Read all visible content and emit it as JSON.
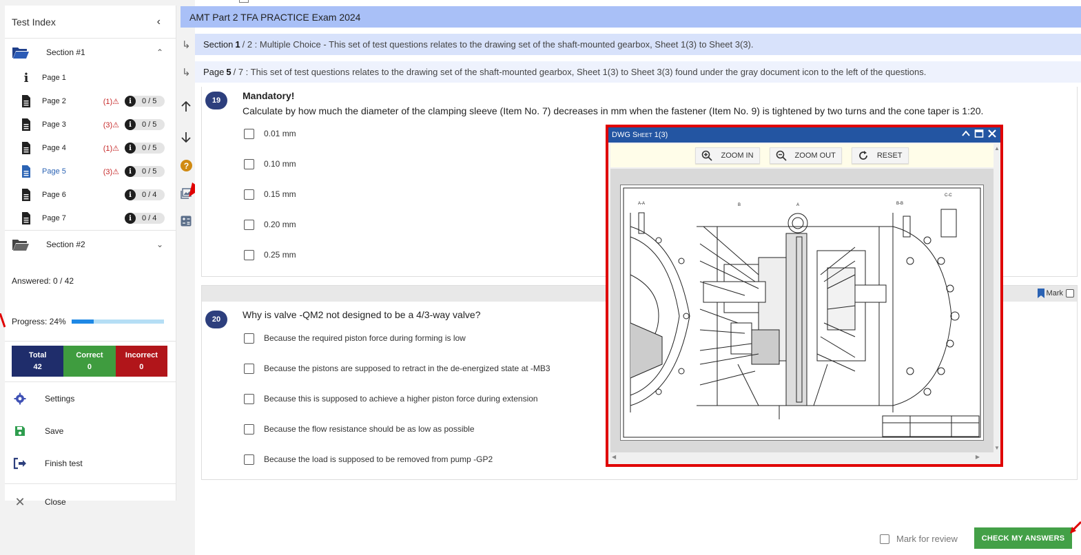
{
  "sidebar": {
    "title": "Test Index",
    "sections": [
      {
        "label": "Section #1"
      },
      {
        "label": "Section #2"
      }
    ],
    "pages": [
      {
        "label": "Page 1",
        "warn": "",
        "score": ""
      },
      {
        "label": "Page 2",
        "warn": "(1)⚠",
        "score": "0 / 5"
      },
      {
        "label": "Page 3",
        "warn": "(3)⚠",
        "score": "0 / 5"
      },
      {
        "label": "Page 4",
        "warn": "(1)⚠",
        "score": "0 / 5"
      },
      {
        "label": "Page 5",
        "warn": "(3)⚠",
        "score": "0 / 5"
      },
      {
        "label": "Page 6",
        "warn": "",
        "score": "0 / 4"
      },
      {
        "label": "Page 7",
        "warn": "",
        "score": "0 / 4"
      }
    ],
    "answered": "Answered: 0 / 42",
    "progress_label": "Progress: 24%",
    "progress_fraction": 0.24,
    "stats": [
      {
        "label": "Total",
        "value": "42",
        "color": "#1f2d6b"
      },
      {
        "label": "Correct",
        "value": "0",
        "color": "#3f9c3f"
      },
      {
        "label": "Incorrect",
        "value": "0",
        "color": "#b1151a"
      }
    ],
    "menu": [
      {
        "label": "Settings",
        "icon": "gear-icon"
      },
      {
        "label": "Save",
        "icon": "save-icon"
      },
      {
        "label": "Finish test",
        "icon": "exit-icon"
      },
      {
        "label": "Close",
        "icon": "close-icon"
      }
    ]
  },
  "header": {
    "title": "AMT Part 2 TFA PRACTICE Exam 2024",
    "section_prefix": "Section",
    "section_num": "1",
    "section_total": "/ 2 : Multiple Choice - This set of test questions relates to the drawing set of the shaft-mounted gearbox, Sheet 1(3) to Sheet 3(3).",
    "page_prefix": "Page",
    "page_num": "5",
    "page_total": "/ 7 : This set of test questions relates to the drawing set of the shaft-mounted gearbox, Sheet 1(3) to Sheet 3(3) found under the gray document icon to the left of the questions."
  },
  "questions": [
    {
      "num": "19",
      "mandatory": "Mandatory!",
      "text": "Calculate by how much the diameter of the clamping sleeve (Item No. 7) decreases in mm when the fastener (Item No. 9) is tightened by two turns and the cone taper is 1:20.",
      "options": [
        "0.01 mm",
        "0.10 mm",
        "0.15 mm",
        "0.20 mm",
        "0.25 mm"
      ]
    },
    {
      "num": "20",
      "text": "Why is valve -QM2 not designed to be a 4/3-way valve?",
      "mark_label": "Mark",
      "options": [
        "Because the required piston force during forming is low",
        "Because the pistons are supposed to retract in the de-energized state at -MB3",
        "Because this is supposed to achieve a higher piston force during extension",
        "Because the flow resistance should be as low as possible",
        "Because the load is supposed to be removed from pump -GP2"
      ]
    }
  ],
  "popup": {
    "title": "DWG Sheet 1(3)",
    "zoom_in": "ZOOM IN",
    "zoom_out": "ZOOM OUT",
    "reset": "RESET"
  },
  "footer": {
    "mark_review": "Mark for review",
    "check": "CHECK MY ANSWERS"
  },
  "colors": {
    "title_bar": "#a9c0f7",
    "accent_red": "#e00000",
    "check_button": "#43a047"
  }
}
